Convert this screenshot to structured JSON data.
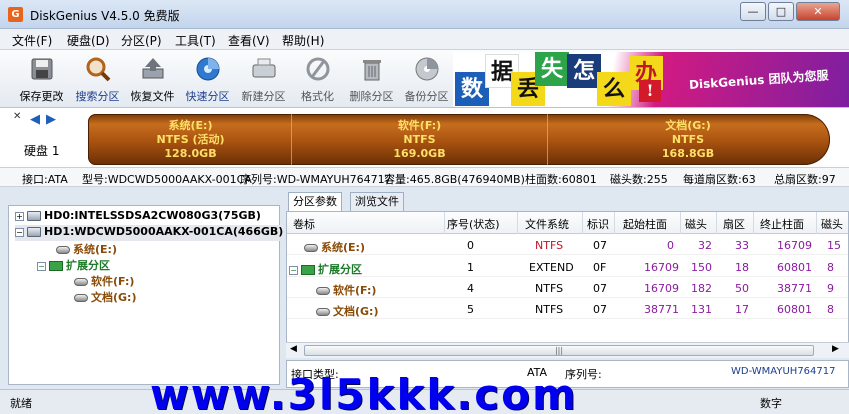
{
  "window": {
    "title": "DiskGenius V4.5.0 免费版",
    "app_icon": "G",
    "min": "—",
    "max": "□",
    "close": "✕"
  },
  "menu": [
    "文件(F)",
    "硬盘(D)",
    "分区(P)",
    "工具(T)",
    "查看(V)",
    "帮助(H)"
  ],
  "toolbar": [
    {
      "label": "保存更改",
      "icon": "save-icon"
    },
    {
      "label": "搜索分区",
      "icon": "search-partition-icon"
    },
    {
      "label": "恢复文件",
      "icon": "recover-file-icon"
    },
    {
      "label": "快速分区",
      "icon": "quick-partition-icon"
    },
    {
      "label": "新建分区",
      "icon": "new-partition-icon"
    },
    {
      "label": "格式化",
      "icon": "format-icon"
    },
    {
      "label": "删除分区",
      "icon": "delete-partition-icon"
    },
    {
      "label": "备份分区",
      "icon": "backup-partition-icon"
    }
  ],
  "banner": {
    "chars": [
      "数",
      "据",
      "丢",
      "失",
      "怎",
      "么",
      "办",
      "!"
    ],
    "brand": "DiskGenius 团队为您服"
  },
  "diskmap": {
    "close": "✕",
    "prev": "◀",
    "next": "▶",
    "disk_label": "硬盘 1",
    "partitions": [
      {
        "name": "系统(E:)",
        "fs": "NTFS (活动)",
        "size": "128.0GB"
      },
      {
        "name": "软件(F:)",
        "fs": "NTFS",
        "size": "169.0GB"
      },
      {
        "name": "文档(G:)",
        "fs": "NTFS",
        "size": "168.8GB"
      }
    ]
  },
  "infobar": {
    "iface": "接口:ATA",
    "model": "型号:WDCWD5000AAKX-001CA",
    "serial": "序列号:WD-WMAYUH764717",
    "capacity": "容量:465.8GB(476940MB)",
    "cylinders": "柱面数:60801",
    "heads": "磁头数:255",
    "sectors_per_track": "每道扇区数:63",
    "total_sectors": "总扇区数:97"
  },
  "tree": {
    "hd0": "HD0:INTELSSDSA2CW080G3(75GB)",
    "hd1": "HD1:WDCWD5000AAKX-001CA(466GB)",
    "sys": "系统(E:)",
    "ext": "扩展分区",
    "soft": "软件(F:)",
    "doc": "文档(G:)"
  },
  "tabs": [
    "分区参数",
    "浏览文件"
  ],
  "table": {
    "headers": [
      "卷标",
      "序号(状态)",
      "文件系统",
      "标识",
      "起始柱面",
      "磁头",
      "扇区",
      "终止柱面",
      "磁头"
    ],
    "rows": [
      {
        "name": "系统(E:)",
        "cells": [
          "0",
          "NTFS",
          "07",
          "0",
          "32",
          "33",
          "16709",
          "15"
        ]
      },
      {
        "name": "扩展分区",
        "cells": [
          "1",
          "EXTEND",
          "0F",
          "16709",
          "150",
          "18",
          "60801",
          "8"
        ]
      },
      {
        "name": "软件(F:)",
        "cells": [
          "4",
          "NTFS",
          "07",
          "16709",
          "182",
          "50",
          "38771",
          "9"
        ]
      },
      {
        "name": "文档(G:)",
        "cells": [
          "5",
          "NTFS",
          "07",
          "38771",
          "131",
          "17",
          "60801",
          "8"
        ]
      }
    ],
    "scroll_grip": "|||"
  },
  "detail": {
    "iface_label": "接口类型:",
    "iface_value": "ATA",
    "serial_label": "序列号:",
    "serial_value": "WD-WMAYUH764717"
  },
  "status": {
    "left": "就绪",
    "right": "数字"
  },
  "watermark": "www.3l5kkk.com",
  "colors": {
    "partition_bar": "#a7520f",
    "partition_text": "#ffe066",
    "tree_text": "#8a4b08",
    "ext_text": "#1d7a28",
    "number_purple": "#8a1aa0",
    "watermark": "#0000ee"
  }
}
